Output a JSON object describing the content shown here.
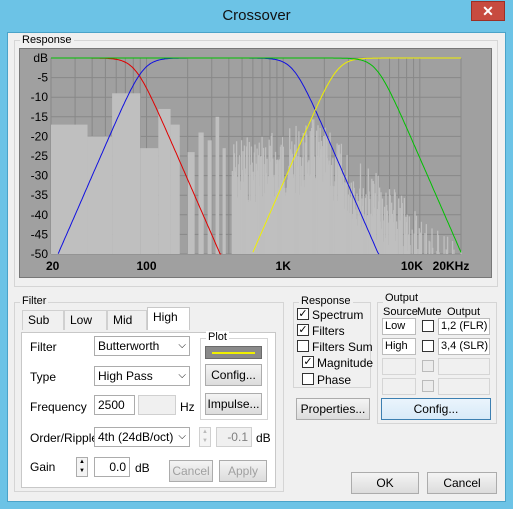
{
  "window": {
    "title": "Crossover",
    "close_label": "✕"
  },
  "response_plot": {
    "group_label": "Response",
    "y_labels": [
      "dB",
      "-5",
      "-10",
      "-15",
      "-20",
      "-25",
      "-30",
      "-35",
      "-40",
      "-45",
      "-50"
    ],
    "x_labels": [
      "20",
      "100",
      "1K",
      "10K",
      "20KHz"
    ],
    "colors": {
      "background": "#a0a0a0",
      "grid": "#888888",
      "spectrum": "#bfbfbf",
      "red": "#e00000",
      "blue": "#1010e0",
      "yellow": "#f0f000",
      "green": "#00c000"
    }
  },
  "filter": {
    "group_label": "Filter",
    "tabs": [
      {
        "label": "Sub"
      },
      {
        "label": "Low"
      },
      {
        "label": "Mid"
      },
      {
        "label": "High"
      }
    ],
    "active_tab": "High",
    "filter_label": "Filter",
    "filter_value": "Butterworth",
    "type_label": "Type",
    "type_value": "High Pass",
    "frequency_label": "Frequency",
    "frequency_value": "2500",
    "frequency_unit": "Hz",
    "order_label": "Order/Ripple",
    "order_value": "4th (24dB/oct)",
    "ripple_value": "-0.1",
    "ripple_unit": "dB",
    "gain_label": "Gain",
    "gain_value": "0.0",
    "gain_unit": "dB",
    "plot_label": "Plot",
    "plot_color": "#f0f000",
    "config_button": "Config...",
    "impulse_button": "Impulse...",
    "cancel_button": "Cancel",
    "apply_button": "Apply"
  },
  "response_options": {
    "group_label": "Response",
    "spectrum": "Spectrum",
    "filters": "Filters",
    "filters_sum": "Filters Sum",
    "magnitude": "Magnitude",
    "phase": "Phase",
    "properties_button": "Properties..."
  },
  "output": {
    "group_label": "Output",
    "headers": [
      "Source",
      "Mute",
      "Output"
    ],
    "rows": [
      {
        "source": "Low",
        "output": "1,2 (FLR)"
      },
      {
        "source": "High",
        "output": "3,4 (SLR)"
      }
    ],
    "config_button": "Config..."
  },
  "dialog": {
    "ok_button": "OK",
    "cancel_button": "Cancel"
  }
}
